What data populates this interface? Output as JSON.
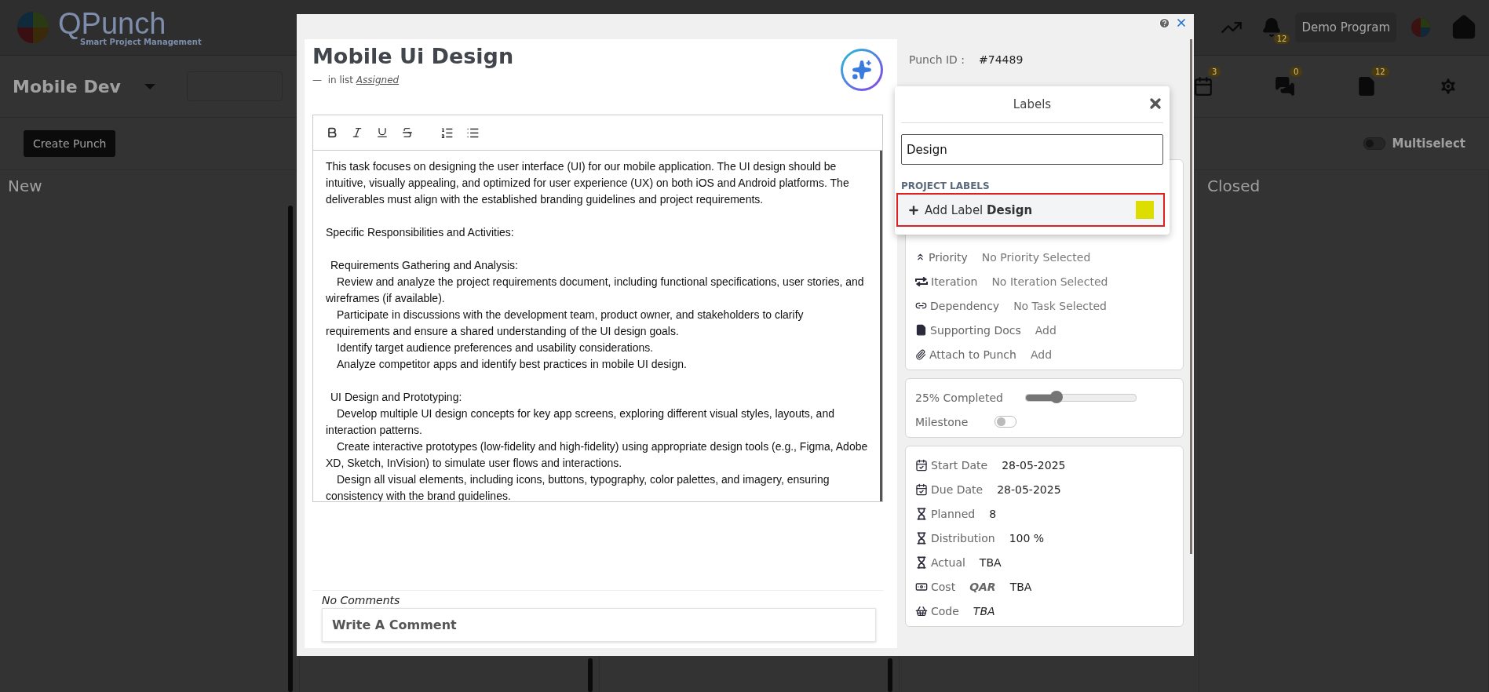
{
  "header": {
    "logo_title": "QPunch",
    "logo_subtitle": "Smart Project Management",
    "notifications_badge": "12",
    "program_button": "Demo Program"
  },
  "project_bar": {
    "project": "Mobile Dev",
    "tools": [
      {
        "kind": "calendar",
        "badge": "3"
      },
      {
        "kind": "chat",
        "badge": "0"
      },
      {
        "kind": "document",
        "badge": "12"
      },
      {
        "kind": "settings"
      }
    ]
  },
  "actions": {
    "create_button": "Create Punch",
    "multiselect": {
      "label": "Multiselect",
      "on": false
    }
  },
  "board_columns": [
    {
      "title": "New"
    },
    {
      "title": "Closed"
    }
  ],
  "modal": {
    "title": "Mobile Ui Design",
    "list_dash": "—",
    "list_prefix": "in list",
    "list_name": "Assigned",
    "editor": {
      "tools": [
        {
          "kind": "bold"
        },
        {
          "kind": "italic"
        },
        {
          "kind": "underline"
        },
        {
          "kind": "strike"
        },
        {
          "kind": "ordered"
        },
        {
          "kind": "bullet"
        }
      ],
      "intro": "This task focuses on designing the user interface (UI) for our mobile application. The UI design should be intuitive, visually appealing, and optimized for user experience (UX) on both iOS and Android platforms. The deliverables must align with the established branding guidelines and project requirements.",
      "heading": "Specific Responsibilities and Activities:",
      "sections": [
        {
          "title": "Requirements Gathering and Analysis:",
          "items": [
            "Review and analyze the project requirements document, including functional specifications, user stories, and wireframes (if available).",
            "Participate in discussions with the development team, product owner, and stakeholders to clarify requirements and ensure a shared understanding of the UI design goals.",
            "Identify target audience preferences and usability considerations.",
            "Analyze competitor apps and identify best practices in mobile UI design."
          ]
        },
        {
          "title": "UI Design and Prototyping:",
          "items": [
            "Develop multiple UI design concepts for key app screens, exploring different visual styles, layouts, and interaction patterns.",
            "Create interactive prototypes (low-fidelity and high-fidelity) using appropriate design tools (e.g., Figma, Adobe XD, Sketch, InVision) to simulate user flows and interactions.",
            "Design all visual elements, including icons, buttons, typography, color palettes, and imagery, ensuring consistency with the brand guidelines."
          ]
        }
      ]
    },
    "comments": {
      "status": "No Comments",
      "placeholder": "Write A Comment"
    },
    "punch_id": {
      "label": "Punch ID :",
      "value": "#74489"
    },
    "details": [
      {
        "kind": "priority",
        "label": "Priority",
        "value": "No Priority Selected"
      },
      {
        "kind": "iteration",
        "label": "Iteration",
        "value": "No Iteration Selected"
      },
      {
        "kind": "dependency",
        "label": "Dependency",
        "value": "No Task Selected"
      },
      {
        "kind": "docs",
        "label": "Supporting Docs",
        "value": "Add"
      },
      {
        "kind": "attach",
        "label": "Attach to Punch",
        "value": "Add"
      }
    ],
    "progress": {
      "label": "25% Completed",
      "level": 0.28
    },
    "milestone": {
      "label": "Milestone",
      "on": false
    },
    "schedule": [
      {
        "kind": "date",
        "label": "Start Date",
        "value": "28-05-2025"
      },
      {
        "kind": "date",
        "label": "Due Date",
        "value": "28-05-2025"
      },
      {
        "kind": "hours",
        "label": "Planned",
        "value": "8"
      },
      {
        "kind": "hours",
        "label": "Distribution",
        "value": "100 %"
      },
      {
        "kind": "hours",
        "label": "Actual",
        "value": "TBA"
      },
      {
        "kind": "cost",
        "label": "Cost",
        "currency": "QAR",
        "value": "TBA"
      },
      {
        "kind": "code",
        "label": "Code",
        "value": "TBA"
      }
    ]
  },
  "labels_popup": {
    "title": "Labels",
    "search_value": "Design",
    "section": "PROJECT LABELS",
    "add_prefix": "Add Label",
    "add_name": "Design",
    "color": "#dddd00",
    "highlighted": true
  }
}
